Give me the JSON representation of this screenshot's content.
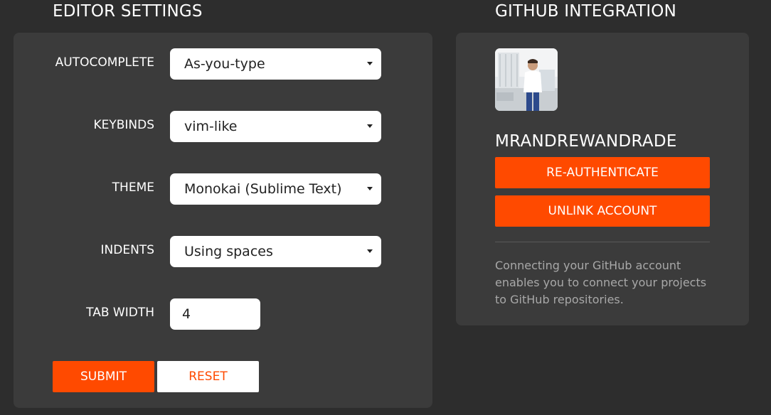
{
  "editor": {
    "title": "EDITOR SETTINGS",
    "fields": [
      {
        "label": "AUTOCOMPLETE",
        "value": "As-you-type"
      },
      {
        "label": "KEYBINDS",
        "value": "vim-like"
      },
      {
        "label": "THEME",
        "value": "Monokai (Sublime Text)"
      },
      {
        "label": "INDENTS",
        "value": "Using spaces"
      }
    ],
    "tab_width": {
      "label": "TAB WIDTH",
      "value": "4"
    },
    "submit_label": "SUBMIT",
    "reset_label": "RESET"
  },
  "github": {
    "title": "GITHUB INTEGRATION",
    "username": "MRANDREWANDRADE",
    "reauth_label": "RE-AUTHENTICATE",
    "unlink_label": "UNLINK ACCOUNT",
    "description": "Connecting your GitHub account enables you to connect your projects to GitHub repositories."
  },
  "colors": {
    "accent": "#ff4a00",
    "background": "#2d2d2d",
    "panel": "#3b3b3b"
  }
}
